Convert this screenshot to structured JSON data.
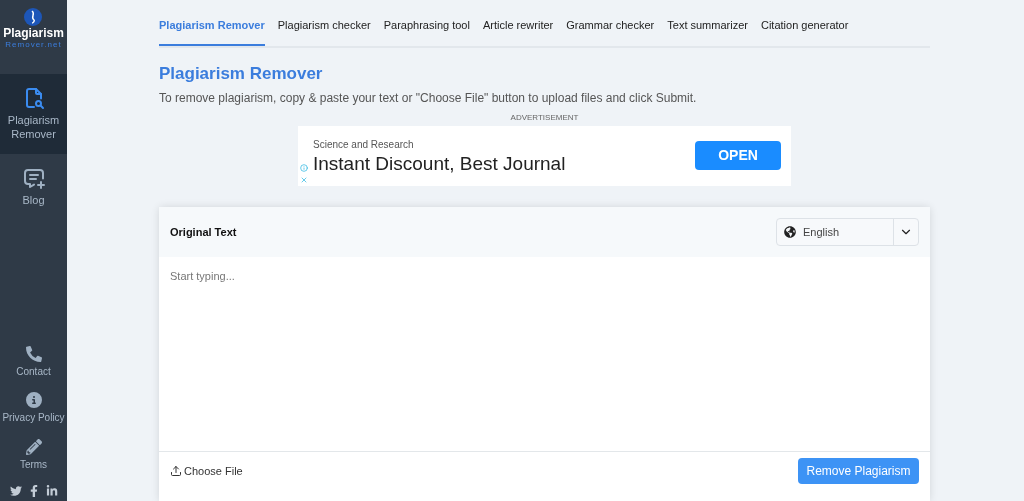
{
  "logo": {
    "name": "Plagiarism",
    "domain": "Remover.net"
  },
  "sidebar": {
    "items": [
      {
        "kind": "remover",
        "label": "Plagiarism Remover",
        "selected": true
      },
      {
        "kind": "blog",
        "label": "Blog",
        "selected": false
      }
    ],
    "bottom_items": [
      {
        "kind": "contact",
        "label": "Contact"
      },
      {
        "kind": "privacy",
        "label": "Privacy Policy"
      },
      {
        "kind": "terms",
        "label": "Terms"
      }
    ]
  },
  "tabs": [
    {
      "label": "Plagiarism Remover",
      "selected": true
    },
    {
      "label": "Plagiarism checker",
      "selected": false
    },
    {
      "label": "Paraphrasing tool",
      "selected": false
    },
    {
      "label": "Article rewriter",
      "selected": false
    },
    {
      "label": "Grammar checker",
      "selected": false
    },
    {
      "label": "Text summarizer",
      "selected": false
    },
    {
      "label": "Citation generator",
      "selected": false
    }
  ],
  "title": "Plagiarism Remover",
  "description": "To remove plagiarism, copy & paste your text or \"Choose File\" button to upload files and click Submit.",
  "ad": {
    "label": "ADVERTISEMENT",
    "source": "Science and Research",
    "headline": "Instant Discount, Best Journal",
    "button": "OPEN"
  },
  "editor": {
    "heading": "Original Text",
    "language": "English",
    "placeholder": "Start typing...",
    "choose_file": "Choose File",
    "submit": "Remove Plagiarism"
  }
}
